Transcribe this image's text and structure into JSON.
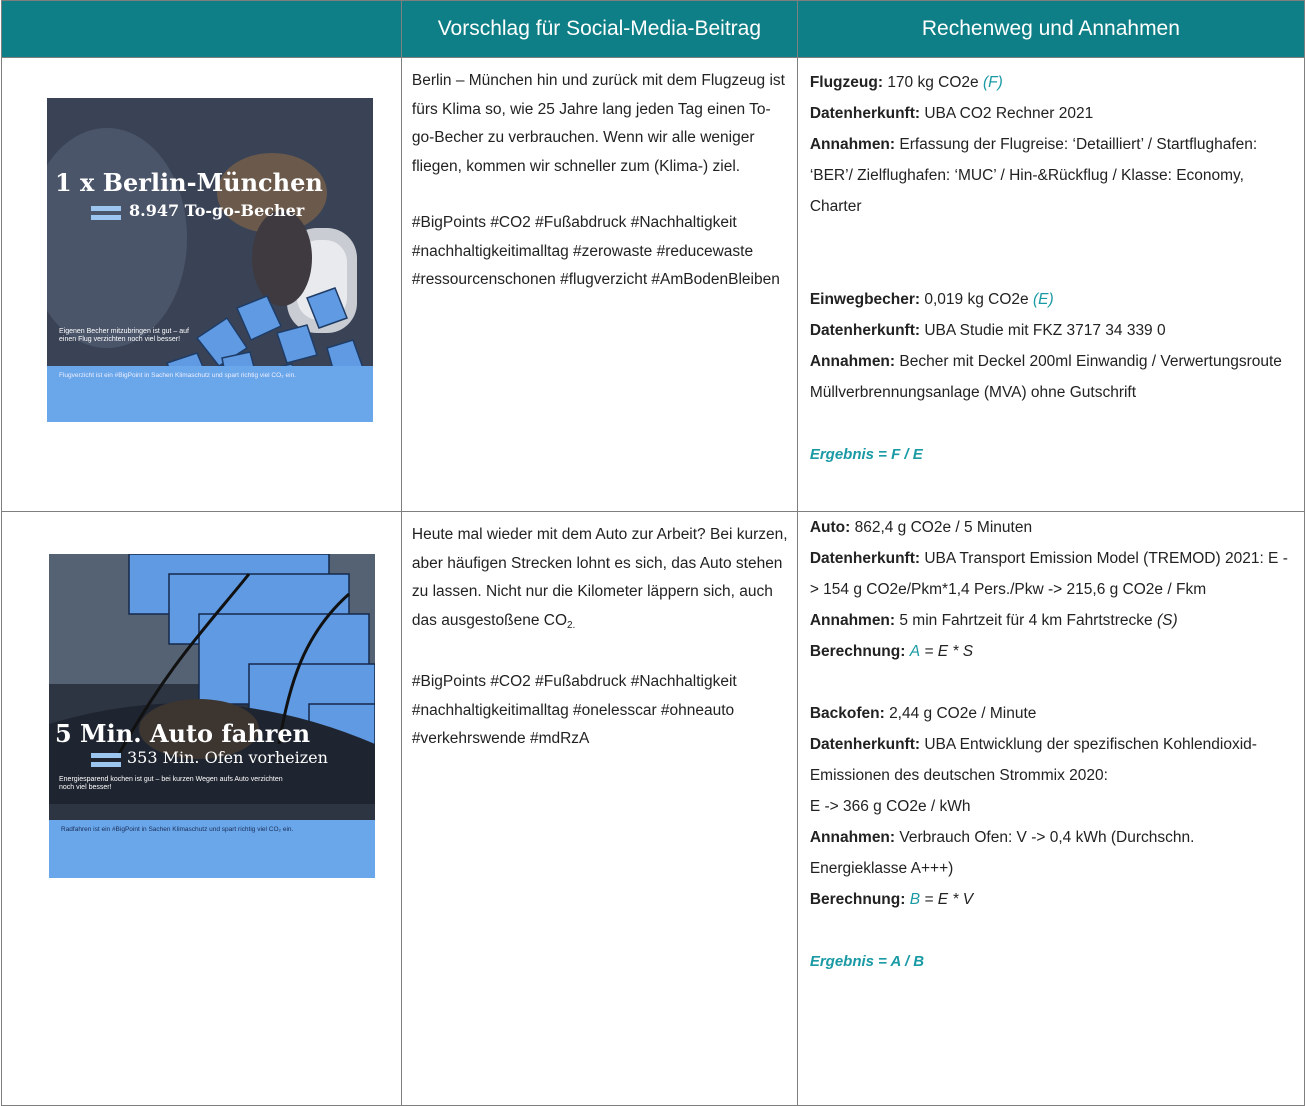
{
  "header": {
    "col2": "Vorschlag für Social-Media-Beitrag",
    "col3": "Rechenweg und Annahmen"
  },
  "rows": [
    {
      "image": {
        "title": "1 x Berlin-München",
        "subtitle": "8.947 To-go-Becher",
        "caption": "Eigenen Becher mitzubringen ist gut – auf einen Flug verzichten noch viel besser!",
        "footer": "Flugverzicht ist ein #BigPoint in Sachen Klimaschutz und spart richtig viel CO₂ ein."
      },
      "post": {
        "text": "Berlin – München hin und zurück mit dem Flugzeug ist fürs Klima so, wie 25 Jahre lang jeden Tag einen To-go-Becher zu verbrauchen. Wenn wir alle weniger fliegen, kommen wir schneller zum (Klima-) ziel.",
        "hashtags": "#BigPoints #CO2 #Fußabdruck #Nachhaltigkeit #nachhaltigkeitimalltag #zerowaste #reducewaste #ressourcenschonen #flugverzicht #AmBodenBleiben"
      },
      "calc": {
        "a_label": "Flugzeug:",
        "a_value": "170 kg CO2e",
        "a_var": "(F)",
        "a_src_label": "Datenherkunft:",
        "a_src": "UBA CO2 Rechner 2021",
        "a_ann_label": "Annahmen:",
        "a_ann": "Erfassung der Flugreise: ‘Detailliert’ / Startflughafen: ‘BER’/ Zielflughafen: ‘MUC’ / Hin-&Rückflug / Klasse: Economy, Charter",
        "b_label": "Einwegbecher:",
        "b_value": "0,019 kg CO2e",
        "b_var": "(E)",
        "b_src_label": "Datenherkunft:",
        "b_src": "UBA Studie mit FKZ 3717 34 339 0",
        "b_ann_label": "Annahmen:",
        "b_ann": "Becher mit Deckel 200ml Einwandig / Verwertungsroute Müllverbrennungsanlage (MVA) ohne Gutschrift",
        "result": "Ergebnis =  F / E"
      }
    },
    {
      "image": {
        "title": "5 Min. Auto fahren",
        "subtitle": "353 Min. Ofen vorheizen",
        "caption": "Energiesparend kochen ist gut – bei kurzen Wegen aufs Auto verzichten noch viel besser!",
        "footer": "Radfahren ist ein #BigPoint in Sachen Klimaschutz und spart richtig viel CO₂ ein."
      },
      "post": {
        "text": "Heute mal wieder mit dem Auto zur Arbeit? Bei kurzen, aber häufigen Strecken lohnt es sich, das Auto stehen zu lassen. Nicht nur die Kilometer läppern sich, auch das ausgestoßene CO",
        "text_sub": "2.",
        "hashtags": "#BigPoints #CO2 #Fußabdruck #Nachhaltigkeit #nachhaltigkeitimalltag #onelesscar #ohneauto #verkehrswende #mdRzA"
      },
      "calc": {
        "a_label": "Auto:",
        "a_value": "862,4 g CO2e / 5 Minuten",
        "a_src_label": "Datenherkunft:",
        "a_src": "UBA Transport Emission Model (TREMOD) 2021: E -> 154 g CO2e/Pkm*1,4 Pers./Pkw -> 215,6 g CO2e / Fkm",
        "a_ann_label": "Annahmen:",
        "a_ann": " 5 min Fahrtzeit für 4 km Fahrtstrecke",
        "a_ann_var": "(S)",
        "a_calc_label": "Berechnung:",
        "a_calc_var": "A",
        "a_calc": "= E  * S",
        "b_label": "Backofen:",
        "b_value": "2,44 g CO2e / Minute",
        "b_src_label": "Datenherkunft:",
        "b_src": "UBA Entwicklung der spezifischen Kohlendioxid-Emissionen des deutschen Strommix 2020:",
        "b_src2": "E -> 366 g CO2e / kWh",
        "b_ann_label": "Annahmen:",
        "b_ann": "Verbrauch Ofen: V -> 0,4 kWh (Durchschn. Energieklasse A+++)",
        "b_calc_label": "Berechnung:",
        "b_calc_var": "B",
        "b_calc": "= E  * V",
        "result": "Ergebnis =  A / B"
      }
    }
  ]
}
